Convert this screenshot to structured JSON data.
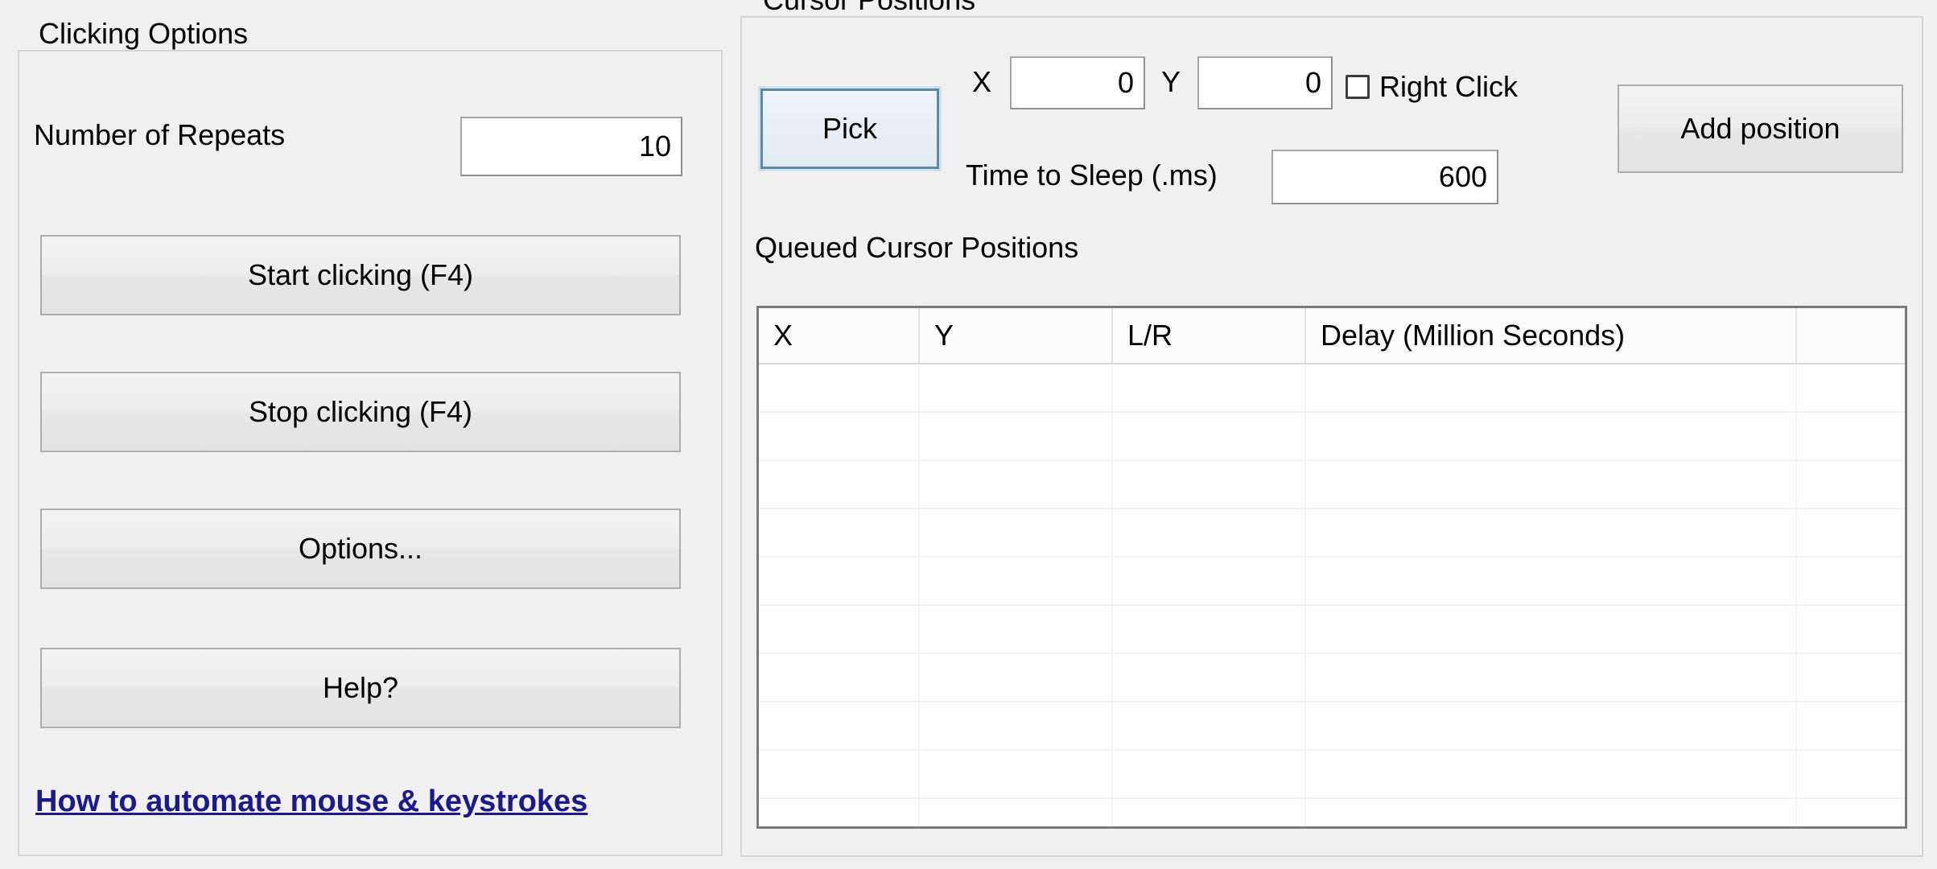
{
  "left_panel": {
    "legend": "Clicking Options",
    "repeats_label": "Number of Repeats",
    "repeats_value": "10",
    "buttons": [
      {
        "name": "start-clicking-button",
        "label": "Start clicking (F4)"
      },
      {
        "name": "stop-clicking-button",
        "label": "Stop clicking (F4)"
      },
      {
        "name": "options-button",
        "label": "Options..."
      },
      {
        "name": "help-button",
        "label": "Help?"
      }
    ],
    "link_label": "How to automate mouse & keystrokes",
    "link_color": "#1a1a8c"
  },
  "right_panel": {
    "legend": "Cursor Positions",
    "pick_button_label": "Pick",
    "x_label": "X",
    "x_value": "0",
    "y_label": "Y",
    "y_value": "0",
    "right_click_label": "Right Click",
    "right_click_checked": false,
    "sleep_label": "Time to Sleep (.ms)",
    "sleep_value": "600",
    "add_position_label": "Add position",
    "queued_label": "Queued Cursor Positions",
    "grid": {
      "columns": [
        "X",
        "Y",
        "L/R",
        "Delay (Million Seconds)",
        ""
      ],
      "rows": [],
      "empty_row_count": 10
    }
  },
  "theme": {
    "window_background": "#f0f0f0",
    "field_background": "#ffffff",
    "border": "#8f8f8f",
    "focus_border": "#5b8aa3"
  }
}
